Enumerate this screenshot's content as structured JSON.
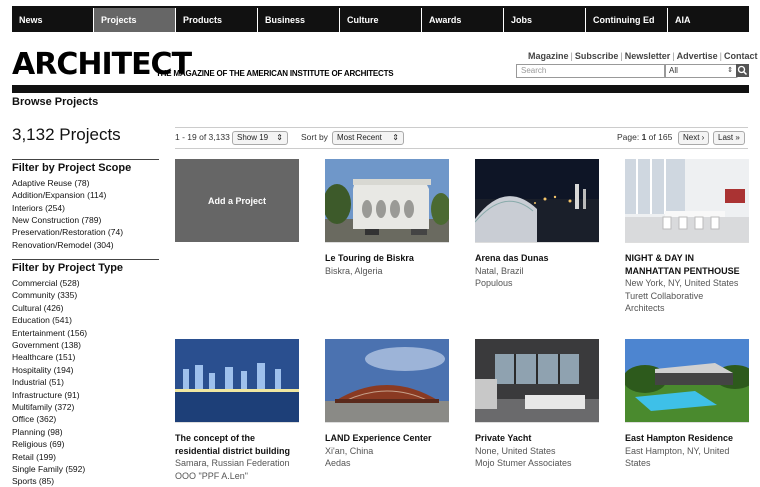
{
  "nav": [
    "News",
    "Projects",
    "Products",
    "Business",
    "Culture",
    "Awards",
    "Jobs",
    "Continuing Ed",
    "AIA"
  ],
  "nav_active": "Projects",
  "header": {
    "logo": "ARCHITECT",
    "tagline": "THE MAGAZINE OF THE AMERICAN INSTITUTE OF ARCHITECTS",
    "util_links": [
      "Magazine",
      "Subscribe",
      "Newsletter",
      "Advertise",
      "Contact"
    ],
    "search_placeholder": "Search",
    "select_value": "All"
  },
  "page": {
    "breadcrumb": "Browse Projects",
    "count": "3,132 Projects"
  },
  "toolbar": {
    "range": "1 - 19 of 3,133",
    "show": "Show 19",
    "sort_label": "Sort by",
    "sort_value": "Most Recent",
    "page_label": "Page: ",
    "page_current": "1",
    "page_of": " of 165",
    "next": "Next ›",
    "last": "Last »"
  },
  "filters": {
    "scope_title": "Filter by Project Scope",
    "scope": [
      "Adaptive Reuse  (78)",
      "Addition/Expansion  (114)",
      "Interiors  (254)",
      "New Construction  (789)",
      "Preservation/Restoration  (74)",
      "Renovation/Remodel  (304)"
    ],
    "type_title": "Filter by Project Type",
    "type": [
      "Commercial  (528)",
      "Community  (335)",
      "Cultural  (426)",
      "Education  (541)",
      "Entertainment  (156)",
      "Government  (138)",
      "Healthcare  (151)",
      "Hospitality  (194)",
      "Industrial  (51)",
      "Infrastructure  (91)",
      "Multifamily  (372)",
      "Office  (362)",
      "Planning  (98)",
      "Religious  (69)",
      "Retail  (199)",
      "Single Family  (592)",
      "Sports  (85)"
    ]
  },
  "add_project": "Add a Project",
  "projects": [
    {
      "title": [
        "Le Touring de Biskra"
      ],
      "lines": [
        "Biskra, Algeria"
      ]
    },
    {
      "title": [
        "Arena das Dunas"
      ],
      "lines": [
        "Natal, Brazil",
        "Populous"
      ]
    },
    {
      "title": [
        "NIGHT & DAY IN",
        "MANHATTAN PENTHOUSE"
      ],
      "lines": [
        "New York, NY, United States",
        "Turett Collaborative",
        "Architects"
      ]
    },
    {
      "title": [
        "The concept of the",
        "residential district building"
      ],
      "lines": [
        "Samara, Russian Federation",
        "OOO \"PPF A.Len\""
      ]
    },
    {
      "title": [
        "LAND Experience Center"
      ],
      "lines": [
        "Xi'an, China",
        "Aedas"
      ]
    },
    {
      "title": [
        "Private Yacht"
      ],
      "lines": [
        "None, United States",
        "Mojo Stumer Associates"
      ]
    },
    {
      "title": [
        "East Hampton Residence"
      ],
      "lines": [
        "East Hampton, NY, United",
        "States"
      ]
    }
  ]
}
